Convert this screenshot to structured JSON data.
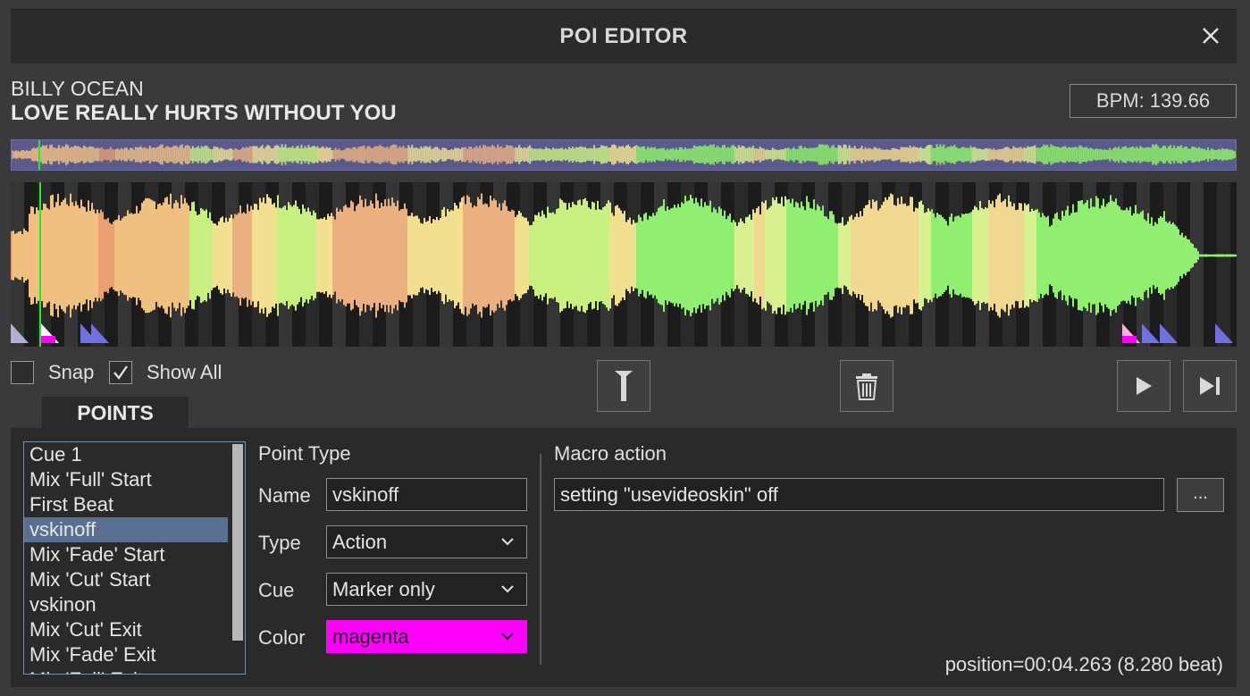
{
  "dialog": {
    "title": "POI EDITOR"
  },
  "track": {
    "artist": "BILLY OCEAN",
    "title": "LOVE REALLY HURTS WITHOUT YOU",
    "bpm_label": "BPM: 139.66"
  },
  "options": {
    "snap_label": "Snap",
    "snap_checked": false,
    "show_all_label": "Show All",
    "show_all_checked": true
  },
  "toolbar": {
    "add_icon": "marker-pin-icon",
    "delete_icon": "trash-icon",
    "play_icon": "play-icon",
    "next_icon": "skip-next-icon"
  },
  "tabs": {
    "points_label": "POINTS"
  },
  "points": {
    "items": [
      "Cue 1",
      "Mix 'Full' Start",
      "First Beat",
      "vskinoff",
      "Mix 'Fade' Start",
      "Mix 'Cut' Start",
      "vskinon",
      "Mix 'Cut' Exit",
      "Mix 'Fade' Exit",
      "Mix 'Full' Exit"
    ],
    "selected_index": 3
  },
  "point_type": {
    "heading": "Point Type",
    "name_label": "Name",
    "name_value": "vskinoff",
    "type_label": "Type",
    "type_value": "Action",
    "cue_label": "Cue",
    "cue_value": "Marker only",
    "color_label": "Color",
    "color_value": "magenta"
  },
  "macro": {
    "heading": "Macro action",
    "value": "setting \"usevideoskin\" off",
    "browse_label": "..."
  },
  "status": {
    "position": "position=00:04.263 (8.280 beat)"
  },
  "colors": {
    "selection": "#5a7090",
    "marker_magenta": "#ff00ff",
    "cursor": "#22ee22",
    "poi_marker": "#8080e0"
  }
}
